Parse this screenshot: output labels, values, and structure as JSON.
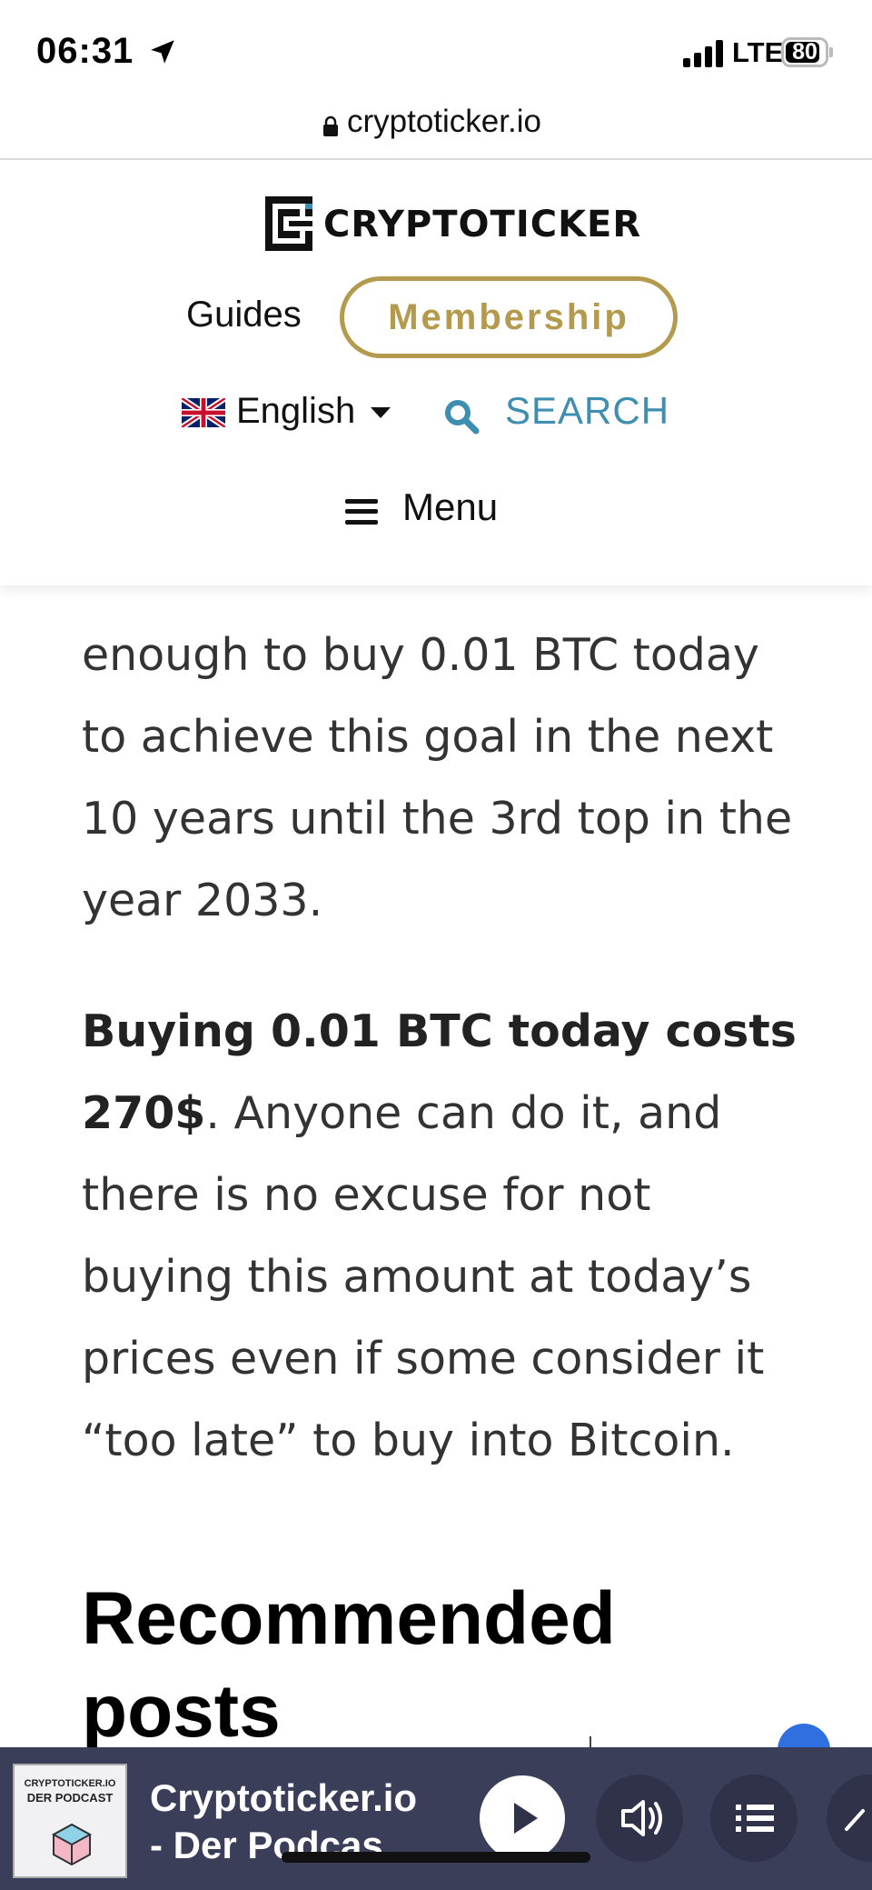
{
  "status_bar": {
    "time": "06:31",
    "network": "LTE",
    "battery": "80",
    "icons": [
      "location-arrow-icon",
      "signal-bars-icon",
      "battery-icon"
    ]
  },
  "browser": {
    "url": "cryptoticker.io"
  },
  "header": {
    "logo_text": "CRYPTOTICKER",
    "nav_guides": "Guides",
    "membership_label": "Membership",
    "language_label": "English",
    "search_label": "SEARCH",
    "menu_label": "Menu"
  },
  "article": {
    "para1": "enough to buy 0.01 BTC today to achieve this goal in the next 10 years until the 3rd top in the year 2033.",
    "para2_bold": "Buying 0.01 BTC today costs 270$",
    "para2_rest": ". Anyone can do it, and there is no excuse for not buying this amount at today’s prices even if some consider it “too late” to buy into Bitcoin.",
    "heading": "Recommended posts"
  },
  "podcast_player": {
    "thumb_line1": "CRYPTOTICKER.IO",
    "thumb_line2": "DER PODCAST",
    "title_line1": "Cryptoticker.io",
    "title_line2": "- Der Podcas"
  },
  "colors": {
    "gold": "#b39a4d",
    "search_blue": "#3d8eb0",
    "player_bg": "#3b3e59"
  }
}
